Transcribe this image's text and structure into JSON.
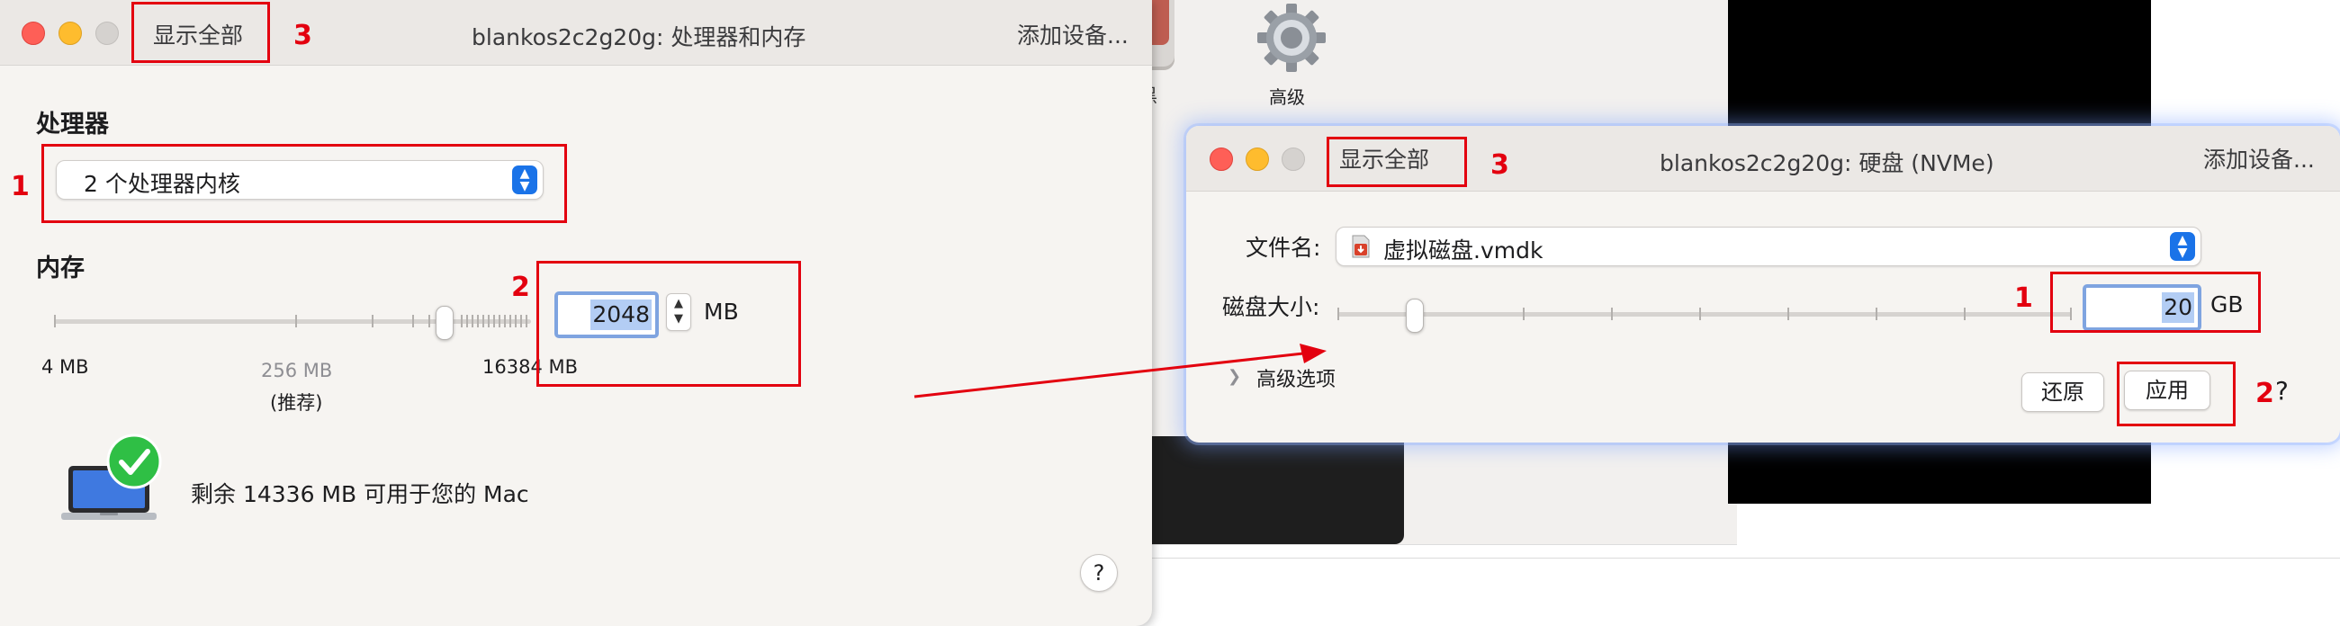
{
  "background": {
    "partial_label": "黑",
    "advanced_label": "高级"
  },
  "window_cpu_memory": {
    "show_all": "显示全部",
    "title": "blankos2c2g20g: 处理器和内存",
    "add_device": "添加设备...",
    "processor": {
      "heading": "处理器",
      "selected": "2 个处理器内核"
    },
    "memory": {
      "heading": "内存",
      "value": "2048",
      "unit": "MB",
      "min_label": "4 MB",
      "recommended_value": "256 MB",
      "recommended_note": "(推荐)",
      "max_label": "16384 MB",
      "remaining_text": "剩余 14336 MB 可用于您的 Mac"
    },
    "help": "?"
  },
  "window_disk": {
    "show_all": "显示全部",
    "title": "blankos2c2g20g: 硬盘 (NVMe)",
    "add_device": "添加设备...",
    "file_label": "文件名:",
    "file_value": "虚拟磁盘.vmdk",
    "size_label": "磁盘大小:",
    "size_value": "20",
    "size_unit": "GB",
    "advanced_options": "高级选项",
    "revert_button": "还原",
    "apply_button": "应用",
    "help": "?"
  },
  "annotations": {
    "w1_num1": "1",
    "w1_num2": "2",
    "w1_num3": "3",
    "w2_num1": "1",
    "w2_num2": "2",
    "w2_num3": "3",
    "color": "#e3000f"
  },
  "icons": {
    "gear": "gear-icon",
    "laptop": "laptop-icon",
    "check": "checkmark-icon",
    "disk_file": "disk-file-icon"
  }
}
